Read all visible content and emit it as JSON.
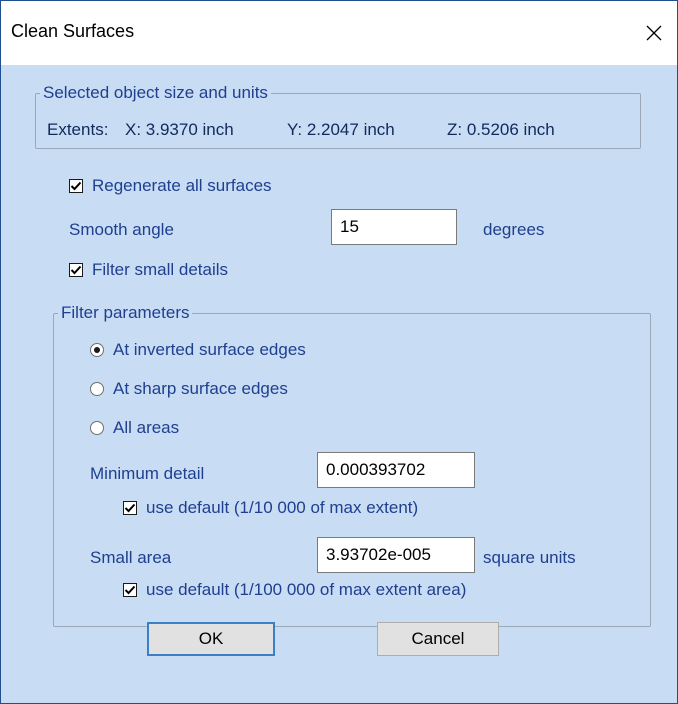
{
  "window": {
    "title": "Clean Surfaces",
    "close_glyph": "✕"
  },
  "info_group": {
    "legend": "Selected object size and units",
    "extents_label": "Extents:",
    "x": "X: 3.9370 inch",
    "y": "Y: 2.2047 inch",
    "z": "Z: 0.5206 inch"
  },
  "regenerate": {
    "label": "Regenerate all surfaces",
    "checked": true
  },
  "smooth_angle": {
    "label": "Smooth angle",
    "value": "15",
    "unit": "degrees"
  },
  "filter_small": {
    "label": "Filter small details",
    "checked": true
  },
  "filter_group": {
    "legend": "Filter parameters",
    "options": [
      {
        "label": "At inverted surface edges",
        "selected": true
      },
      {
        "label": "At sharp surface edges",
        "selected": false
      },
      {
        "label": "All areas",
        "selected": false
      }
    ],
    "minimum_detail": {
      "label": "Minimum detail",
      "value": "0.000393702",
      "use_default": {
        "label": "use default (1/10 000 of max extent)",
        "checked": true
      }
    },
    "small_area": {
      "label": "Small area",
      "value": "3.93702e-005",
      "unit": "square units",
      "use_default": {
        "label": "use default (1/100 000 of max extent area)",
        "checked": true
      }
    }
  },
  "buttons": {
    "ok": "OK",
    "cancel": "Cancel"
  },
  "colors": {
    "background": "#c8dcf4",
    "label_text": "#1f3f8f",
    "default_button_border": "#3c7fc8"
  }
}
